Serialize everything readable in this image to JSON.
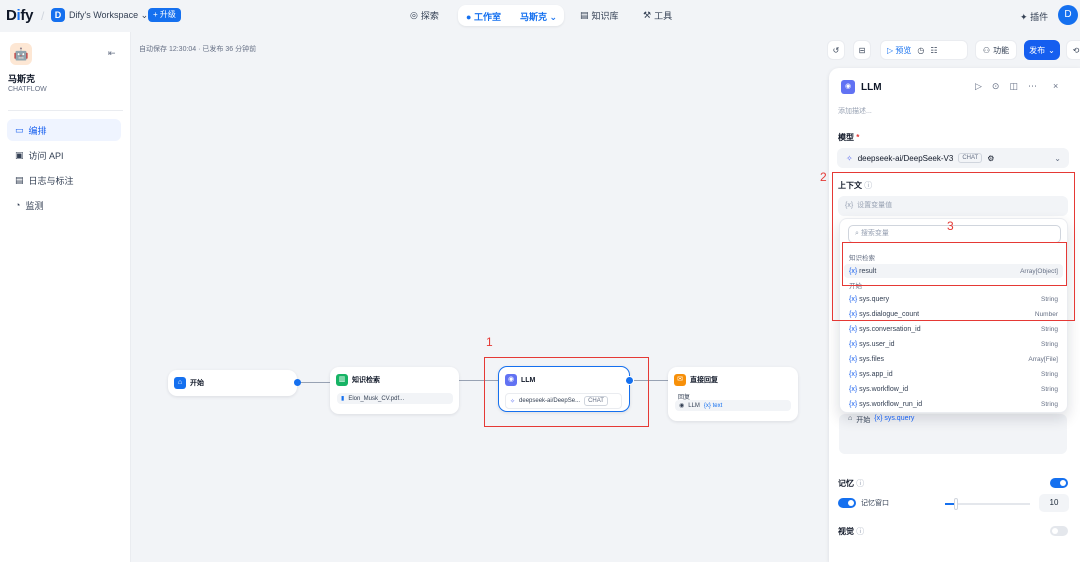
{
  "topbar": {
    "logo": "Dify",
    "workspace_initial": "D",
    "workspace_name": "Dify's Workspace",
    "upgrade": "升级",
    "explore": "探索",
    "studio": "工作室",
    "app_crumb": "马斯克",
    "knowledge": "知识库",
    "tools": "工具",
    "plugins": "插件",
    "user_initial": "D"
  },
  "sidebar": {
    "app_name": "马斯克",
    "app_type": "CHATFLOW",
    "items": [
      {
        "label": "编排",
        "active": true
      },
      {
        "label": "访问 API"
      },
      {
        "label": "日志与标注"
      },
      {
        "label": "监测"
      }
    ]
  },
  "canvas": {
    "autosave": "自动保存 12:30:04 · 已发布 36 分钟前",
    "nodes": {
      "start": {
        "title": "开始"
      },
      "knowledge": {
        "title": "知识检索",
        "file": "Elon_Musk_CV.pdf..."
      },
      "llm": {
        "title": "LLM",
        "model": "deepseek-ai/DeepSe...",
        "tag": "CHAT"
      },
      "answer": {
        "title": "直接回复",
        "label": "回复",
        "ref_node": "LLM",
        "ref_var": "text"
      }
    }
  },
  "toolbar": {
    "preview": "预览",
    "features": "功能",
    "publish": "发布"
  },
  "panel": {
    "title": "LLM",
    "desc": "添加描述...",
    "model_label": "模型",
    "model_name": "deepseek-ai/DeepSeek-V3",
    "model_tag": "CHAT",
    "context_label": "上下文",
    "context_placeholder": "设置变量值",
    "memory_label": "记忆",
    "memory_window_label": "记忆窗口",
    "memory_window_value": "10",
    "vision_label": "视觉"
  },
  "dropdown": {
    "search_placeholder": "搜索变量",
    "groups": [
      {
        "name": "知识检索",
        "vars": [
          {
            "name": "result",
            "type": "Array[Object]"
          }
        ]
      },
      {
        "name": "开始",
        "vars": [
          {
            "name": "sys.query",
            "type": "String"
          },
          {
            "name": "sys.dialogue_count",
            "type": "Number"
          },
          {
            "name": "sys.conversation_id",
            "type": "String"
          },
          {
            "name": "sys.user_id",
            "type": "String"
          },
          {
            "name": "sys.files",
            "type": "Array[File]"
          },
          {
            "name": "sys.app_id",
            "type": "String"
          },
          {
            "name": "sys.workflow_id",
            "type": "String"
          },
          {
            "name": "sys.workflow_run_id",
            "type": "String"
          }
        ]
      }
    ]
  },
  "prompt": {
    "node": "开始",
    "var": "sys.query"
  },
  "annotations": {
    "n1": "1",
    "n2": "2",
    "n3": "3"
  },
  "colors": {
    "accent": "#1570ef",
    "annotation": "#e53935"
  }
}
